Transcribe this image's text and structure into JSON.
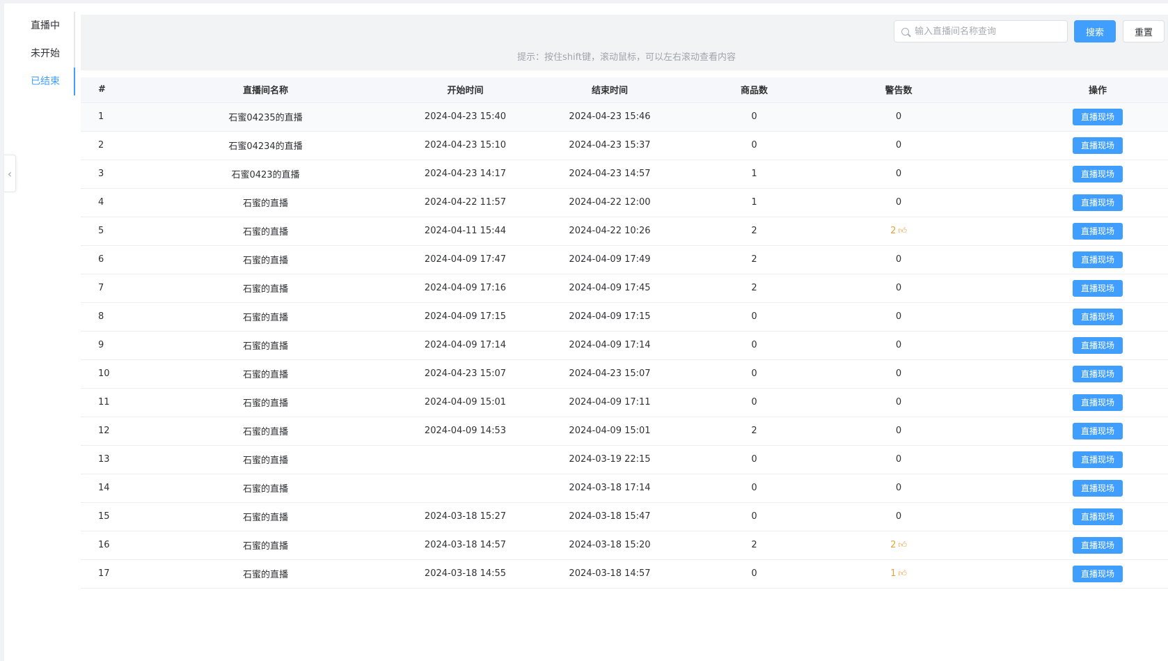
{
  "sidebar": {
    "tabs": [
      {
        "label": "直播中"
      },
      {
        "label": "未开始"
      },
      {
        "label": "已结束"
      }
    ],
    "active_index": 2
  },
  "search": {
    "placeholder": "输入直播间名称查询",
    "value": "",
    "search_label": "搜索",
    "reset_label": "重置",
    "tip": "提示：按住shift键，滚动鼠标，可以左右滚动查看内容"
  },
  "table": {
    "headers": {
      "index": "#",
      "name": "直播间名称",
      "start": "开始时间",
      "end": "结束时间",
      "goods": "商品数",
      "warnings": "警告数",
      "action": "操作"
    },
    "action_label": "直播现场",
    "rows": [
      {
        "index": "1",
        "name": "石蜜04235的直播",
        "start": "2024-04-23 15:40",
        "end": "2024-04-23 15:46",
        "goods": "0",
        "warnings": "0",
        "warning_icon": false
      },
      {
        "index": "2",
        "name": "石蜜04234的直播",
        "start": "2024-04-23 15:10",
        "end": "2024-04-23 15:37",
        "goods": "0",
        "warnings": "0",
        "warning_icon": false
      },
      {
        "index": "3",
        "name": "石蜜0423的直播",
        "start": "2024-04-23 14:17",
        "end": "2024-04-23 14:57",
        "goods": "1",
        "warnings": "0",
        "warning_icon": false
      },
      {
        "index": "4",
        "name": "石蜜的直播",
        "start": "2024-04-22 11:57",
        "end": "2024-04-22 12:00",
        "goods": "1",
        "warnings": "0",
        "warning_icon": false
      },
      {
        "index": "5",
        "name": "石蜜的直播",
        "start": "2024-04-11 15:44",
        "end": "2024-04-22 10:26",
        "goods": "2",
        "warnings": "2",
        "warning_icon": true
      },
      {
        "index": "6",
        "name": "石蜜的直播",
        "start": "2024-04-09 17:47",
        "end": "2024-04-09 17:49",
        "goods": "2",
        "warnings": "0",
        "warning_icon": false
      },
      {
        "index": "7",
        "name": "石蜜的直播",
        "start": "2024-04-09 17:16",
        "end": "2024-04-09 17:45",
        "goods": "2",
        "warnings": "0",
        "warning_icon": false
      },
      {
        "index": "8",
        "name": "石蜜的直播",
        "start": "2024-04-09 17:15",
        "end": "2024-04-09 17:15",
        "goods": "0",
        "warnings": "0",
        "warning_icon": false
      },
      {
        "index": "9",
        "name": "石蜜的直播",
        "start": "2024-04-09 17:14",
        "end": "2024-04-09 17:14",
        "goods": "0",
        "warnings": "0",
        "warning_icon": false
      },
      {
        "index": "10",
        "name": "石蜜的直播",
        "start": "2024-04-23 15:07",
        "end": "2024-04-23 15:07",
        "goods": "0",
        "warnings": "0",
        "warning_icon": false
      },
      {
        "index": "11",
        "name": "石蜜的直播",
        "start": "2024-04-09 15:01",
        "end": "2024-04-09 17:11",
        "goods": "0",
        "warnings": "0",
        "warning_icon": false
      },
      {
        "index": "12",
        "name": "石蜜的直播",
        "start": "2024-04-09 14:53",
        "end": "2024-04-09 15:01",
        "goods": "2",
        "warnings": "0",
        "warning_icon": false
      },
      {
        "index": "13",
        "name": "石蜜的直播",
        "start": "",
        "end": "2024-03-19 22:15",
        "goods": "0",
        "warnings": "0",
        "warning_icon": false
      },
      {
        "index": "14",
        "name": "石蜜的直播",
        "start": "",
        "end": "2024-03-18 17:14",
        "goods": "0",
        "warnings": "0",
        "warning_icon": false
      },
      {
        "index": "15",
        "name": "石蜜的直播",
        "start": "2024-03-18 15:27",
        "end": "2024-03-18 15:47",
        "goods": "0",
        "warnings": "0",
        "warning_icon": false
      },
      {
        "index": "16",
        "name": "石蜜的直播",
        "start": "2024-03-18 14:57",
        "end": "2024-03-18 15:20",
        "goods": "2",
        "warnings": "2",
        "warning_icon": true
      },
      {
        "index": "17",
        "name": "石蜜的直播",
        "start": "2024-03-18 14:55",
        "end": "2024-03-18 14:57",
        "goods": "0",
        "warnings": "1",
        "warning_icon": true
      }
    ]
  },
  "colors": {
    "primary": "#409eff",
    "warning": "#e6a23c"
  },
  "icons": {
    "collapse": "chevron-left-icon",
    "search": "search-icon",
    "warning_flag": "thumbs-up-icon"
  }
}
